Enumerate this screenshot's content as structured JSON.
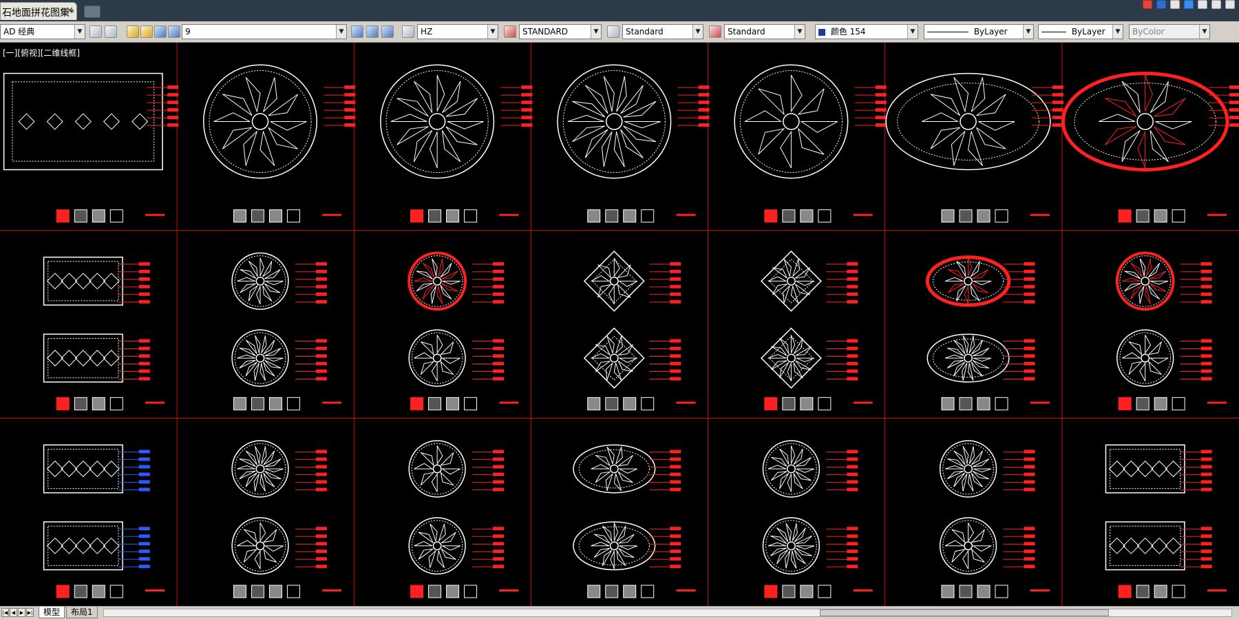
{
  "document_tab": {
    "title": "石地面拼花图集*",
    "close_glyph": "×"
  },
  "toolbar": {
    "workspace": "AD 经典",
    "layer_value": "9",
    "text_style": "HZ",
    "dim_style": "STANDARD",
    "table_style": "Standard",
    "multileader_style": "Standard",
    "color": "颜色 154",
    "linetype": "ByLayer",
    "lineweight": "ByLayer",
    "plotstyle": "ByColor"
  },
  "canvas": {
    "viewport_label": "[一][俯视][二维线框]",
    "background": "#000000",
    "grid_color": "#cc1010",
    "drawing_color": "#ffffff",
    "annotation_color": "#ff2020",
    "dimension_color": "#2a5cff",
    "grid_columns": 7,
    "grid_rows": 3
  },
  "layout_tabs": [
    {
      "label": "模型",
      "active": true
    },
    {
      "label": "布局1",
      "active": false
    }
  ]
}
